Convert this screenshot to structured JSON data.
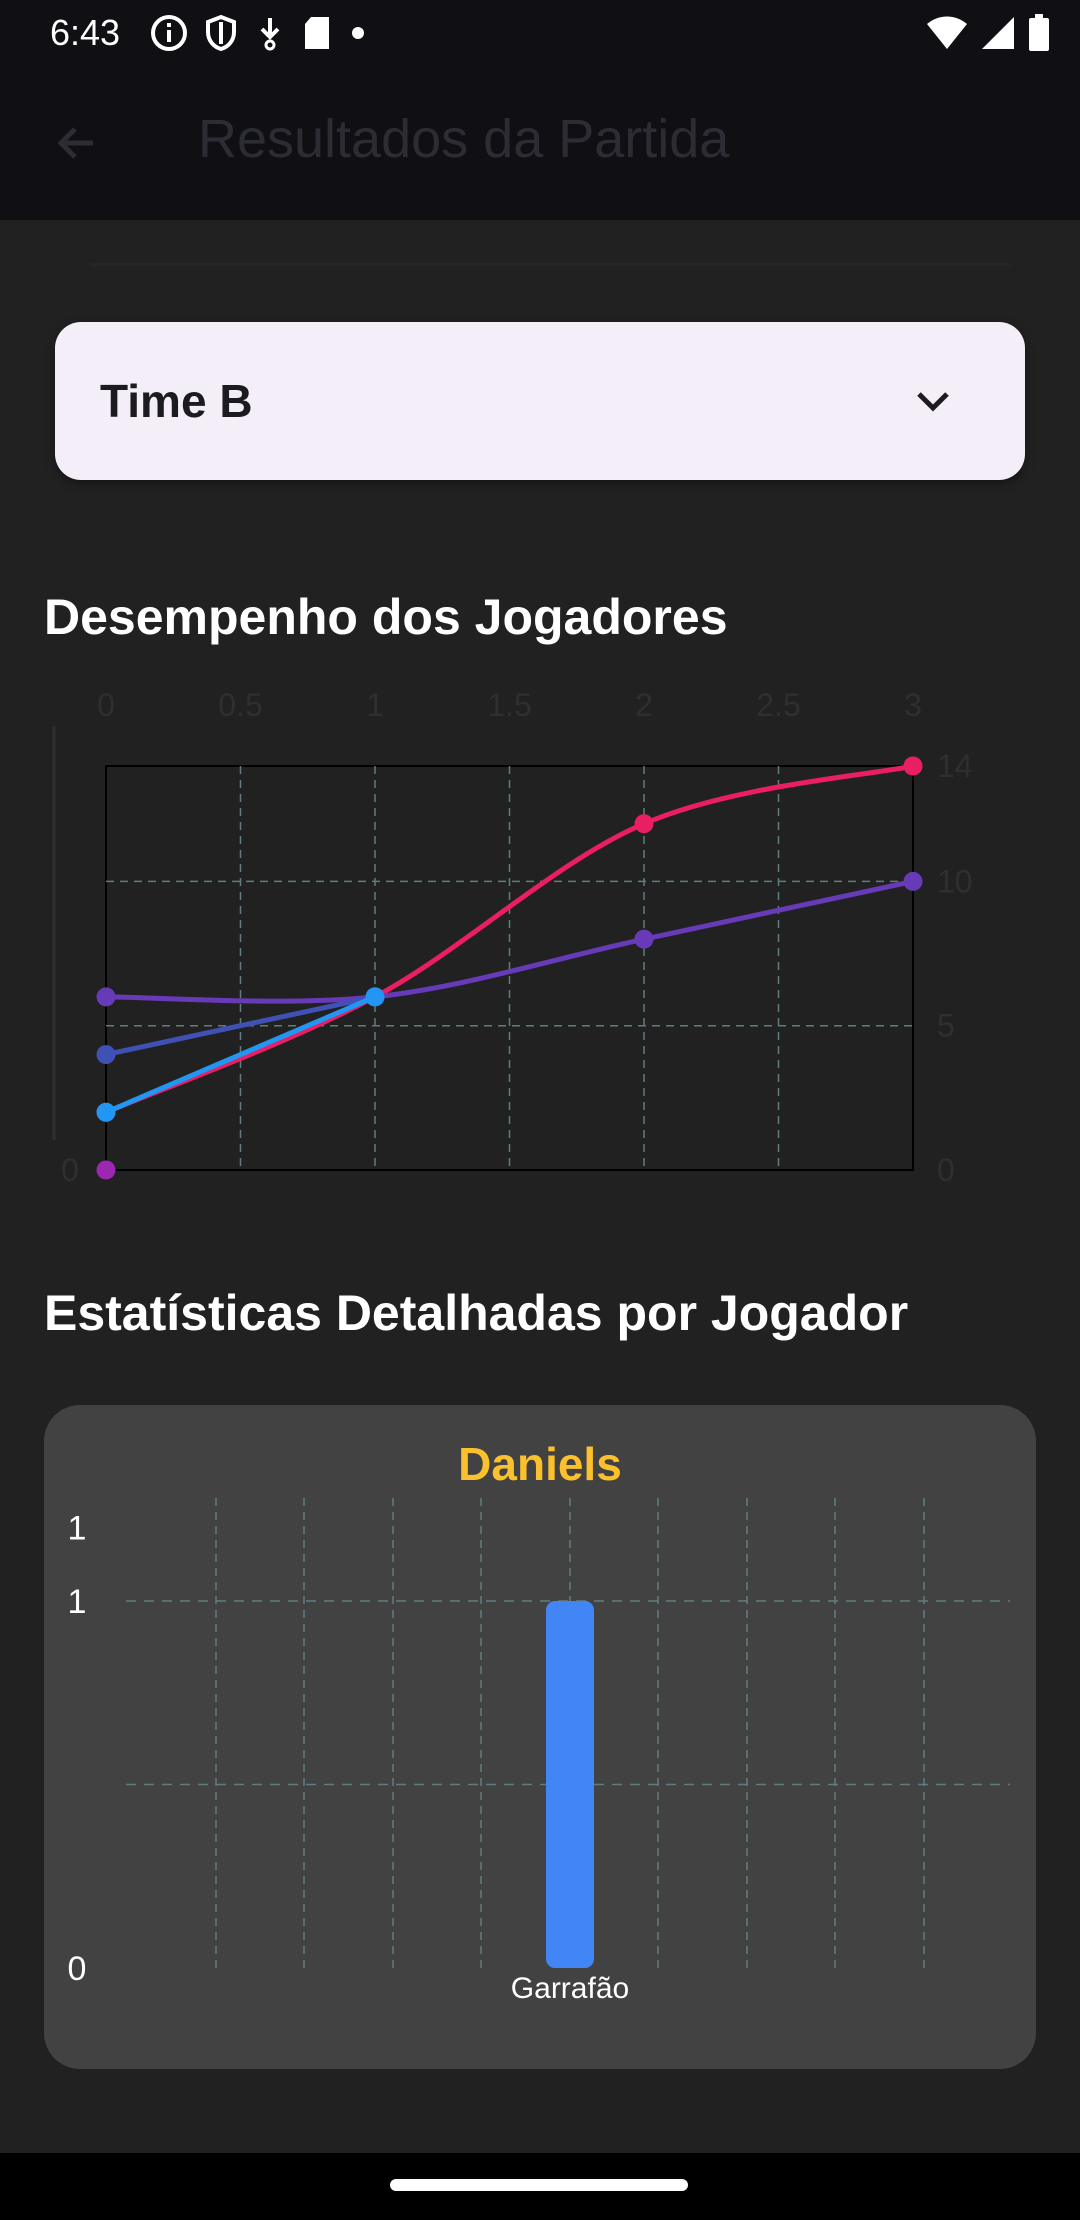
{
  "status_bar": {
    "time": "6:43"
  },
  "app_bar": {
    "title": "Resultados da Partida"
  },
  "team_dropdown": {
    "selected": "Time B"
  },
  "sections": {
    "performance_title": "Desempenho dos Jogadores",
    "stats_title": "Estatísticas Detalhadas por Jogador"
  },
  "colors": {
    "background": "#212121",
    "card": "#424242",
    "accent_title": "#fbc02d",
    "bar": "#4285f4"
  },
  "icons": {
    "back": "arrow-left",
    "dropdown": "chevron-down",
    "status_left": [
      "info-circle",
      "shield",
      "download",
      "sd-card",
      "dot"
    ],
    "status_right": [
      "wifi",
      "cellular-signal",
      "battery"
    ]
  },
  "chart_data": [
    {
      "type": "line",
      "top_ticks": [
        "0",
        "0.5",
        "1",
        "1.5",
        "2",
        "2.5",
        "3"
      ],
      "left_ticks": [
        "0"
      ],
      "right_ticks": [
        "0",
        "5",
        "10",
        "14"
      ],
      "xlim": [
        0,
        3
      ],
      "ylim": [
        0,
        14
      ],
      "grid": true,
      "series": [
        {
          "color": "#e91e63",
          "points": [
            [
              0,
              2
            ],
            [
              1,
              6
            ],
            [
              2,
              12
            ],
            [
              3,
              14
            ]
          ]
        },
        {
          "color": "#673ab7",
          "points": [
            [
              0,
              6
            ],
            [
              1,
              6
            ],
            [
              2,
              8
            ],
            [
              3,
              10
            ]
          ]
        },
        {
          "color": "#3f51b5",
          "points": [
            [
              0,
              4
            ],
            [
              1,
              6
            ]
          ]
        },
        {
          "color": "#2196f3",
          "points": [
            [
              0,
              2
            ],
            [
              1,
              6
            ]
          ]
        },
        {
          "color": "#9c27b0",
          "points": [
            [
              0,
              0
            ]
          ]
        }
      ]
    },
    {
      "type": "bar",
      "title": "Daniels",
      "categories": [
        "Garrafão"
      ],
      "values": [
        1
      ],
      "y_ticks": [
        "1",
        "1",
        "0"
      ],
      "ylim": [
        0,
        1.2
      ],
      "grid": true
    }
  ]
}
